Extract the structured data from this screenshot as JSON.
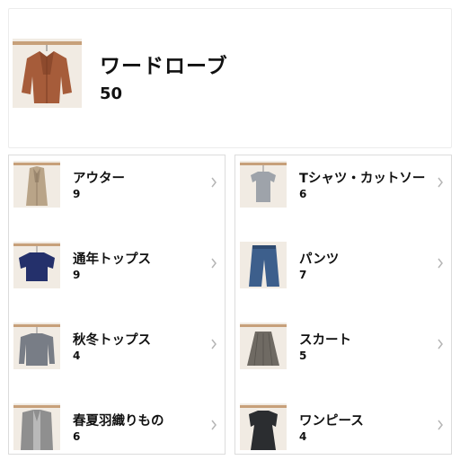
{
  "wardrobe": {
    "title": "ワードローブ",
    "count": "50",
    "thumb_icon": "leather-jacket-photo"
  },
  "left_column": {
    "items": [
      {
        "label": "アウター",
        "count": "9",
        "icon": "trench-coat-photo"
      },
      {
        "label": "通年トップス",
        "count": "9",
        "icon": "navy-top-photo"
      },
      {
        "label": "秋冬トップス",
        "count": "4",
        "icon": "gray-sweater-photo"
      },
      {
        "label": "春夏羽織りもの",
        "count": "6",
        "icon": "gray-cardigan-photo"
      }
    ]
  },
  "right_column": {
    "items": [
      {
        "label": "Tシャツ・カットソー",
        "count": "6",
        "icon": "gray-tshirt-photo"
      },
      {
        "label": "パンツ",
        "count": "7",
        "icon": "jeans-photo"
      },
      {
        "label": "スカート",
        "count": "5",
        "icon": "pleated-skirt-photo"
      },
      {
        "label": "ワンピース",
        "count": "4",
        "icon": "black-dress-photo"
      }
    ]
  },
  "colors": {
    "thumb_background": "#f1ebe3",
    "wood_rail": "#c7a07a",
    "chevron": "#b5b5b5"
  }
}
